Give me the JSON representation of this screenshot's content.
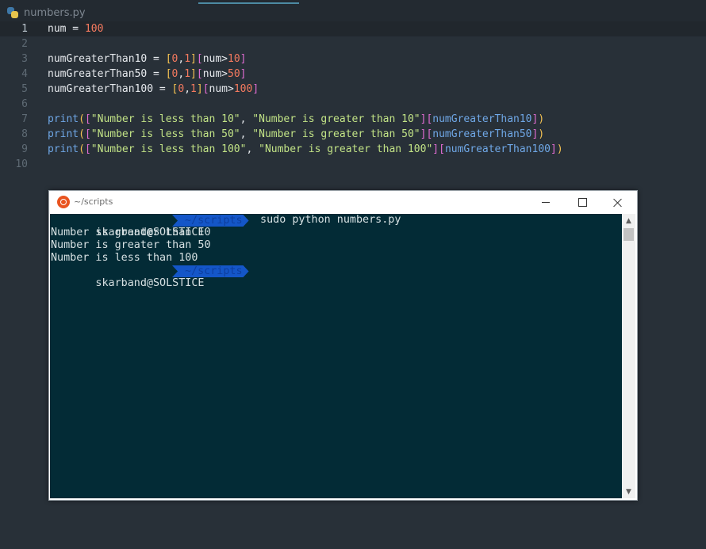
{
  "editor": {
    "tab_label": "numbers.py",
    "lines": [
      {
        "n": "1",
        "tokens": [
          [
            "t-id",
            "num"
          ],
          [
            "t-op",
            " = "
          ],
          [
            "t-num",
            "100"
          ]
        ]
      },
      {
        "n": "2",
        "tokens": []
      },
      {
        "n": "3",
        "tokens": [
          [
            "t-id",
            "numGreaterThan10"
          ],
          [
            "t-op",
            " = "
          ],
          [
            "t-br1",
            "["
          ],
          [
            "t-num",
            "0"
          ],
          [
            "t-op",
            ","
          ],
          [
            "t-num",
            "1"
          ],
          [
            "t-br1",
            "]"
          ],
          [
            "t-br2",
            "["
          ],
          [
            "t-id",
            "num"
          ],
          [
            "t-gt",
            ">"
          ],
          [
            "t-num",
            "10"
          ],
          [
            "t-br2",
            "]"
          ]
        ]
      },
      {
        "n": "4",
        "tokens": [
          [
            "t-id",
            "numGreaterThan50"
          ],
          [
            "t-op",
            " = "
          ],
          [
            "t-br1",
            "["
          ],
          [
            "t-num",
            "0"
          ],
          [
            "t-op",
            ","
          ],
          [
            "t-num",
            "1"
          ],
          [
            "t-br1",
            "]"
          ],
          [
            "t-br2",
            "["
          ],
          [
            "t-id",
            "num"
          ],
          [
            "t-gt",
            ">"
          ],
          [
            "t-num",
            "50"
          ],
          [
            "t-br2",
            "]"
          ]
        ]
      },
      {
        "n": "5",
        "tokens": [
          [
            "t-id",
            "numGreaterThan100"
          ],
          [
            "t-op",
            " = "
          ],
          [
            "t-br1",
            "["
          ],
          [
            "t-num",
            "0"
          ],
          [
            "t-op",
            ","
          ],
          [
            "t-num",
            "1"
          ],
          [
            "t-br1",
            "]"
          ],
          [
            "t-br2",
            "["
          ],
          [
            "t-id",
            "num"
          ],
          [
            "t-gt",
            ">"
          ],
          [
            "t-num",
            "100"
          ],
          [
            "t-br2",
            "]"
          ]
        ]
      },
      {
        "n": "6",
        "tokens": []
      },
      {
        "n": "7",
        "tokens": [
          [
            "t-fn",
            "print"
          ],
          [
            "t-br1",
            "("
          ],
          [
            "t-br2",
            "["
          ],
          [
            "t-str",
            "\"Number is less than 10\""
          ],
          [
            "t-op",
            ", "
          ],
          [
            "t-str",
            "\"Number is greater than 10\""
          ],
          [
            "t-br2",
            "]"
          ],
          [
            "t-br2",
            "["
          ],
          [
            "t-var",
            "numGreaterThan10"
          ],
          [
            "t-br2",
            "]"
          ],
          [
            "t-br1",
            ")"
          ]
        ]
      },
      {
        "n": "8",
        "tokens": [
          [
            "t-fn",
            "print"
          ],
          [
            "t-br1",
            "("
          ],
          [
            "t-br2",
            "["
          ],
          [
            "t-str",
            "\"Number is less than 50\""
          ],
          [
            "t-op",
            ", "
          ],
          [
            "t-str",
            "\"Number is greater than 50\""
          ],
          [
            "t-br2",
            "]"
          ],
          [
            "t-br2",
            "["
          ],
          [
            "t-var",
            "numGreaterThan50"
          ],
          [
            "t-br2",
            "]"
          ],
          [
            "t-br1",
            ")"
          ]
        ]
      },
      {
        "n": "9",
        "tokens": [
          [
            "t-fn",
            "print"
          ],
          [
            "t-br1",
            "("
          ],
          [
            "t-br2",
            "["
          ],
          [
            "t-str",
            "\"Number is less than 100\""
          ],
          [
            "t-op",
            ", "
          ],
          [
            "t-str",
            "\"Number is greater than 100\""
          ],
          [
            "t-br2",
            "]"
          ],
          [
            "t-br2",
            "["
          ],
          [
            "t-var",
            "numGreaterThan100"
          ],
          [
            "t-br2",
            "]"
          ],
          [
            "t-br1",
            ")"
          ]
        ]
      },
      {
        "n": "10",
        "tokens": []
      }
    ]
  },
  "terminal": {
    "title": "~/scripts",
    "prompt1": {
      "user": " skarband@SOLSTICE",
      "path": "~/scripts",
      "command": " sudo python numbers.py"
    },
    "output": [
      "Number is greater than 10",
      "Number is greater than 50",
      "Number is less than 100"
    ],
    "prompt2": {
      "user": " skarband@SOLSTICE",
      "path": "~/scripts"
    }
  },
  "colors": {
    "accent": "#1456c8",
    "terminal_bg": "#032b36",
    "editor_bg": "#283038"
  }
}
